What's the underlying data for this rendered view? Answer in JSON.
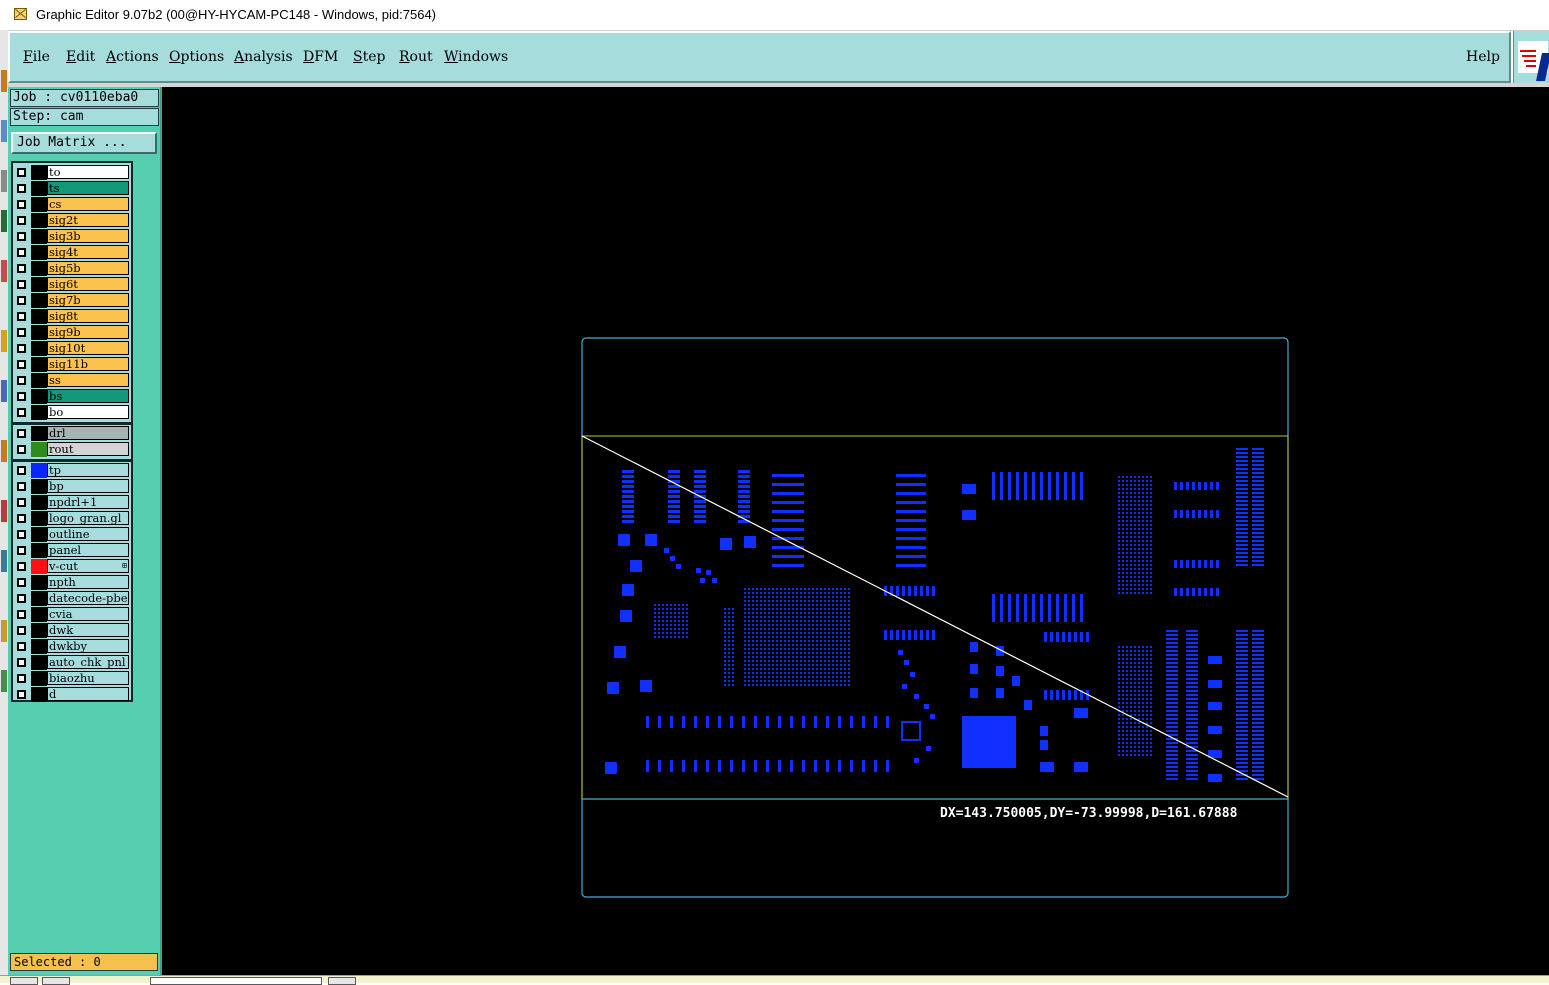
{
  "window": {
    "title": "Graphic Editor 9.07b2 (00@HY-HYCAM-PC148 - Windows, pid:7564)"
  },
  "menubar": {
    "items": [
      {
        "label": "File"
      },
      {
        "label": "Edit"
      },
      {
        "label": "Actions"
      },
      {
        "label": "Options"
      },
      {
        "label": "Analysis"
      },
      {
        "label": "DFM"
      },
      {
        "label": "Step"
      },
      {
        "label": "Rout"
      },
      {
        "label": "Windows"
      }
    ],
    "help": "Help"
  },
  "sidebar": {
    "job": "Job : cv0110eba0",
    "step": "Step: cam",
    "job_matrix": "Job Matrix ...",
    "selected": "Selected : 0",
    "layers": [
      {
        "name": "to",
        "color": "#ffffff",
        "swatch": "#000000"
      },
      {
        "name": "ts",
        "color": "#15987a",
        "swatch": "#000000"
      },
      {
        "name": "cs",
        "color": "#fbc24f",
        "swatch": "#000000"
      },
      {
        "name": "sig2t",
        "color": "#fbc24f",
        "swatch": "#000000"
      },
      {
        "name": "sig3b",
        "color": "#fbc24f",
        "swatch": "#000000"
      },
      {
        "name": "sig4t",
        "color": "#fbc24f",
        "swatch": "#000000"
      },
      {
        "name": "sig5b",
        "color": "#fbc24f",
        "swatch": "#000000"
      },
      {
        "name": "sig6t",
        "color": "#fbc24f",
        "swatch": "#000000"
      },
      {
        "name": "sig7b",
        "color": "#fbc24f",
        "swatch": "#000000"
      },
      {
        "name": "sig8t",
        "color": "#fbc24f",
        "swatch": "#000000"
      },
      {
        "name": "sig9b",
        "color": "#fbc24f",
        "swatch": "#000000"
      },
      {
        "name": "sig10t",
        "color": "#fbc24f",
        "swatch": "#000000"
      },
      {
        "name": "sig11b",
        "color": "#fbc24f",
        "swatch": "#000000"
      },
      {
        "name": "ss",
        "color": "#fbc24f",
        "swatch": "#000000"
      },
      {
        "name": "bs",
        "color": "#15987a",
        "swatch": "#000000"
      },
      {
        "name": "bo",
        "color": "#ffffff",
        "swatch": "#000000"
      },
      {
        "name": "drl",
        "color": "#a6b4b4",
        "swatch": "#000000"
      },
      {
        "name": "rout",
        "color": "#d4d4d4",
        "swatch": "#2e8b1e"
      },
      {
        "name": "tp",
        "color": "#a6dcdc",
        "swatch": "#0a27ff"
      },
      {
        "name": "bp",
        "color": "#a6dcdc",
        "swatch": "#000000"
      },
      {
        "name": "npdrl+1",
        "color": "#a6dcdc",
        "swatch": "#000000"
      },
      {
        "name": "logo_gran.gl",
        "color": "#a6dcdc",
        "swatch": "#000000"
      },
      {
        "name": "outline",
        "color": "#a6dcdc",
        "swatch": "#000000"
      },
      {
        "name": "panel",
        "color": "#a6dcdc",
        "swatch": "#000000"
      },
      {
        "name": "v-cut",
        "color": "#a6dcdc",
        "swatch": "#ff1010",
        "marker": "⊞"
      },
      {
        "name": "npth",
        "color": "#a6dcdc",
        "swatch": "#000000"
      },
      {
        "name": "datecode-pbe",
        "color": "#a6dcdc",
        "swatch": "#000000"
      },
      {
        "name": "cvia",
        "color": "#a6dcdc",
        "swatch": "#000000"
      },
      {
        "name": "dwk",
        "color": "#a6dcdc",
        "swatch": "#000000"
      },
      {
        "name": "dwkby",
        "color": "#a6dcdc",
        "swatch": "#000000"
      },
      {
        "name": "auto_chk_pnl",
        "color": "#a6dcdc",
        "swatch": "#000000"
      },
      {
        "name": "biaozhu",
        "color": "#a6dcdc",
        "swatch": "#000000"
      },
      {
        "name": "d",
        "color": "#a6dcdc",
        "swatch": "#000000"
      }
    ]
  },
  "canvas": {
    "measure_readout": "DX=143.750005,DY=-73.99998,D=161.67888",
    "colors": {
      "background": "#000000",
      "board_outline": "#4aa8d8",
      "board_edge_yellow": "#b8c83a",
      "pad_color": "#1030ff",
      "measure_line": "#ffffff"
    }
  }
}
